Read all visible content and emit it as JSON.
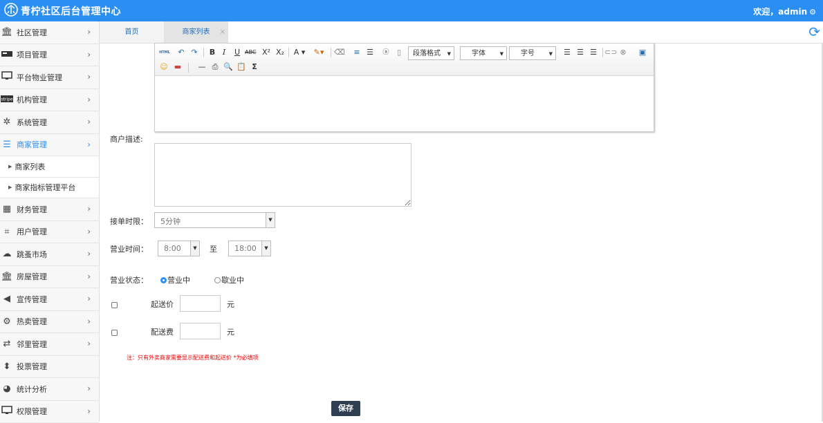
{
  "header": {
    "title": "青柠社区后台管理中心",
    "welcome": "欢迎，admin"
  },
  "sidebar": {
    "items": [
      {
        "label": "社区管理",
        "icon": "bank-icon"
      },
      {
        "label": "项目管理",
        "icon": "card-icon"
      },
      {
        "label": "平台物业管理",
        "icon": "monitor-icon"
      },
      {
        "label": "机构管理",
        "icon": "stripe-icon",
        "icon_text": "stripe"
      },
      {
        "label": "系统管理",
        "icon": "yelp-icon"
      },
      {
        "label": "商家管理",
        "icon": "list-icon",
        "active": true
      },
      {
        "label": "财务管理",
        "icon": "calculator-icon"
      },
      {
        "label": "用户管理",
        "icon": "crop-icon"
      },
      {
        "label": "跳蚤市场",
        "icon": "cloud-icon"
      },
      {
        "label": "房屋管理",
        "icon": "bank-icon"
      },
      {
        "label": "宣传管理",
        "icon": "volume-icon"
      },
      {
        "label": "热卖管理",
        "icon": "gear-icon"
      },
      {
        "label": "邻里管理",
        "icon": "retweet-icon"
      },
      {
        "label": "投票管理",
        "icon": "sort-icon"
      },
      {
        "label": "统计分析",
        "icon": "pie-chart-icon"
      },
      {
        "label": "权限管理",
        "icon": "desktop-icon"
      }
    ],
    "subitems": [
      "商家列表",
      "商家指标管理平台"
    ]
  },
  "tabs": [
    {
      "label": "首页"
    },
    {
      "label": "商家列表",
      "close": "×"
    }
  ],
  "editor": {
    "paragraph_select": "段落格式",
    "font_select": "字体",
    "size_select": "字号"
  },
  "form": {
    "desc_label": "商户描述:",
    "order_limit_label": "接单时限：",
    "order_limit_value": "5分钟",
    "hours_label": "营业时间：",
    "hours_start": "8:00",
    "hours_to": "至",
    "hours_end": "18:00",
    "status_label": "营业状态：",
    "status_open": "营业中",
    "status_closed": "歇业中",
    "min_price_label": "起送价",
    "min_price_unit": "元",
    "delivery_fee_label": "配送费",
    "delivery_fee_unit": "元",
    "note": "注：只有外卖商家需要显示配送费和起送价 *为必填项",
    "save": "保存"
  },
  "colors": {
    "accent": "#2a8ef2",
    "save_button": "#2f3f52",
    "note": "#e00000"
  }
}
